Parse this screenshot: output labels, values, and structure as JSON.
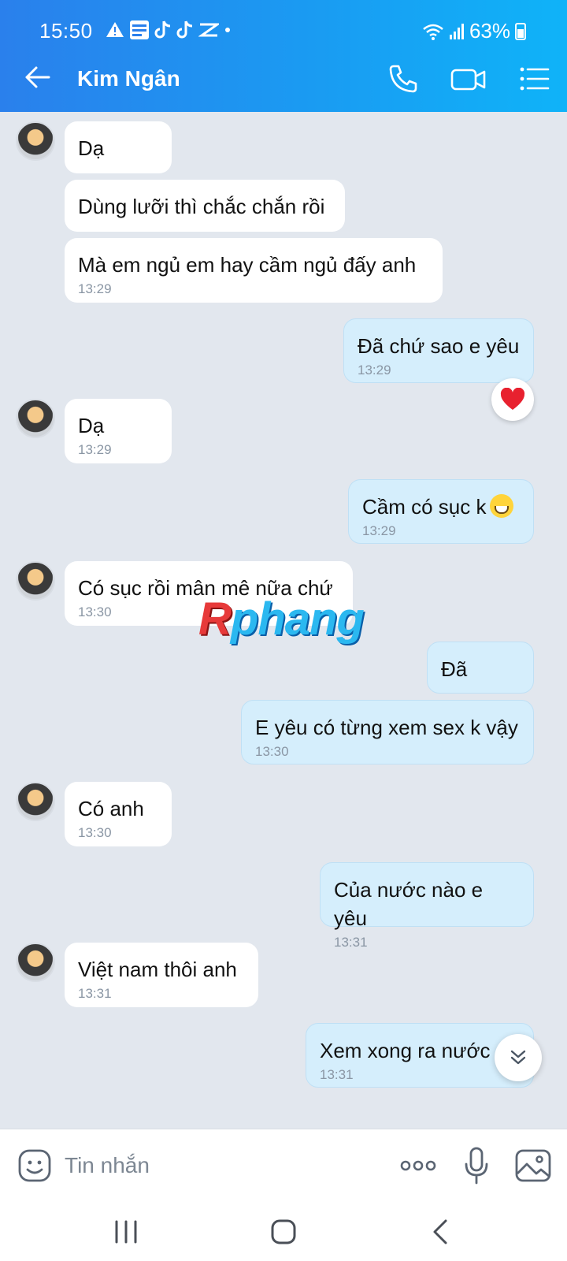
{
  "status_bar": {
    "time": "15:50",
    "battery": "63%"
  },
  "header": {
    "back_label": "back",
    "contact_name": "Kim Ngân"
  },
  "messages": [
    {
      "side": "in",
      "text": "Dạ",
      "time": ""
    },
    {
      "side": "in",
      "text": "Dùng lưỡi thì chắc chắn rồi",
      "time": ""
    },
    {
      "side": "in",
      "text": "Mà em ngủ em hay cầm ngủ đấy anh",
      "time": "13:29"
    },
    {
      "side": "out",
      "text": "Đã chứ sao e yêu",
      "time": "13:29"
    },
    {
      "side": "in",
      "text": "Dạ",
      "time": "13:29"
    },
    {
      "side": "out",
      "text": "Cầm có sục k",
      "time": "13:29"
    },
    {
      "side": "in",
      "text": "Có sục rồi mân mê nữa chứ",
      "time": "13:30"
    },
    {
      "side": "out",
      "text": "Đã",
      "time": ""
    },
    {
      "side": "out",
      "text": "E yêu có từng xem sex k vậy",
      "time": "13:30"
    },
    {
      "side": "in",
      "text": "Có anh",
      "time": "13:30"
    },
    {
      "side": "out",
      "text": "Của nước nào e yêu",
      "time": "13:31"
    },
    {
      "side": "in",
      "text": "Việt nam thôi anh",
      "time": "13:31"
    },
    {
      "side": "out",
      "text": "Xem xong ra nước",
      "time": "13:31"
    }
  ],
  "reaction": {
    "icon": "heart-icon",
    "color": "#e8212f"
  },
  "watermark": {
    "text_r": "R",
    "text_rest": "phang"
  },
  "composer": {
    "placeholder": "Tin nhắn"
  },
  "colors": {
    "header_start": "#2a80ec",
    "header_end": "#0fb3f8",
    "outgoing_bubble": "#d5eefc",
    "incoming_bubble": "#ffffff",
    "chat_bg": "#e2e7ee"
  }
}
